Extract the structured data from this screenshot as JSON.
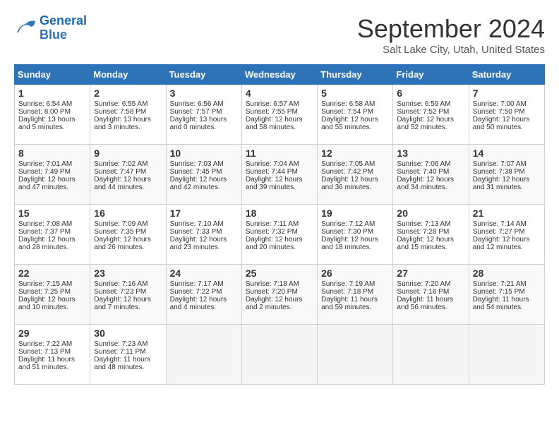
{
  "header": {
    "logo_line1": "General",
    "logo_line2": "Blue",
    "month_title": "September 2024",
    "location": "Salt Lake City, Utah, United States"
  },
  "days_of_week": [
    "Sunday",
    "Monday",
    "Tuesday",
    "Wednesday",
    "Thursday",
    "Friday",
    "Saturday"
  ],
  "weeks": [
    [
      {
        "day": "1",
        "sunrise": "6:54 AM",
        "sunset": "8:00 PM",
        "daylight": "13 hours and 5 minutes."
      },
      {
        "day": "2",
        "sunrise": "6:55 AM",
        "sunset": "7:58 PM",
        "daylight": "13 hours and 3 minutes."
      },
      {
        "day": "3",
        "sunrise": "6:56 AM",
        "sunset": "7:57 PM",
        "daylight": "13 hours and 0 minutes."
      },
      {
        "day": "4",
        "sunrise": "6:57 AM",
        "sunset": "7:55 PM",
        "daylight": "12 hours and 58 minutes."
      },
      {
        "day": "5",
        "sunrise": "6:58 AM",
        "sunset": "7:54 PM",
        "daylight": "12 hours and 55 minutes."
      },
      {
        "day": "6",
        "sunrise": "6:59 AM",
        "sunset": "7:52 PM",
        "daylight": "12 hours and 52 minutes."
      },
      {
        "day": "7",
        "sunrise": "7:00 AM",
        "sunset": "7:50 PM",
        "daylight": "12 hours and 50 minutes."
      }
    ],
    [
      {
        "day": "8",
        "sunrise": "7:01 AM",
        "sunset": "7:49 PM",
        "daylight": "12 hours and 47 minutes."
      },
      {
        "day": "9",
        "sunrise": "7:02 AM",
        "sunset": "7:47 PM",
        "daylight": "12 hours and 44 minutes."
      },
      {
        "day": "10",
        "sunrise": "7:03 AM",
        "sunset": "7:45 PM",
        "daylight": "12 hours and 42 minutes."
      },
      {
        "day": "11",
        "sunrise": "7:04 AM",
        "sunset": "7:44 PM",
        "daylight": "12 hours and 39 minutes."
      },
      {
        "day": "12",
        "sunrise": "7:05 AM",
        "sunset": "7:42 PM",
        "daylight": "12 hours and 36 minutes."
      },
      {
        "day": "13",
        "sunrise": "7:06 AM",
        "sunset": "7:40 PM",
        "daylight": "12 hours and 34 minutes."
      },
      {
        "day": "14",
        "sunrise": "7:07 AM",
        "sunset": "7:38 PM",
        "daylight": "12 hours and 31 minutes."
      }
    ],
    [
      {
        "day": "15",
        "sunrise": "7:08 AM",
        "sunset": "7:37 PM",
        "daylight": "12 hours and 28 minutes."
      },
      {
        "day": "16",
        "sunrise": "7:09 AM",
        "sunset": "7:35 PM",
        "daylight": "12 hours and 26 minutes."
      },
      {
        "day": "17",
        "sunrise": "7:10 AM",
        "sunset": "7:33 PM",
        "daylight": "12 hours and 23 minutes."
      },
      {
        "day": "18",
        "sunrise": "7:11 AM",
        "sunset": "7:32 PM",
        "daylight": "12 hours and 20 minutes."
      },
      {
        "day": "19",
        "sunrise": "7:12 AM",
        "sunset": "7:30 PM",
        "daylight": "12 hours and 18 minutes."
      },
      {
        "day": "20",
        "sunrise": "7:13 AM",
        "sunset": "7:28 PM",
        "daylight": "12 hours and 15 minutes."
      },
      {
        "day": "21",
        "sunrise": "7:14 AM",
        "sunset": "7:27 PM",
        "daylight": "12 hours and 12 minutes."
      }
    ],
    [
      {
        "day": "22",
        "sunrise": "7:15 AM",
        "sunset": "7:25 PM",
        "daylight": "12 hours and 10 minutes."
      },
      {
        "day": "23",
        "sunrise": "7:16 AM",
        "sunset": "7:23 PM",
        "daylight": "12 hours and 7 minutes."
      },
      {
        "day": "24",
        "sunrise": "7:17 AM",
        "sunset": "7:22 PM",
        "daylight": "12 hours and 4 minutes."
      },
      {
        "day": "25",
        "sunrise": "7:18 AM",
        "sunset": "7:20 PM",
        "daylight": "12 hours and 2 minutes."
      },
      {
        "day": "26",
        "sunrise": "7:19 AM",
        "sunset": "7:18 PM",
        "daylight": "11 hours and 59 minutes."
      },
      {
        "day": "27",
        "sunrise": "7:20 AM",
        "sunset": "7:16 PM",
        "daylight": "11 hours and 56 minutes."
      },
      {
        "day": "28",
        "sunrise": "7:21 AM",
        "sunset": "7:15 PM",
        "daylight": "11 hours and 54 minutes."
      }
    ],
    [
      {
        "day": "29",
        "sunrise": "7:22 AM",
        "sunset": "7:13 PM",
        "daylight": "11 hours and 51 minutes."
      },
      {
        "day": "30",
        "sunrise": "7:23 AM",
        "sunset": "7:11 PM",
        "daylight": "11 hours and 48 minutes."
      },
      null,
      null,
      null,
      null,
      null
    ]
  ]
}
